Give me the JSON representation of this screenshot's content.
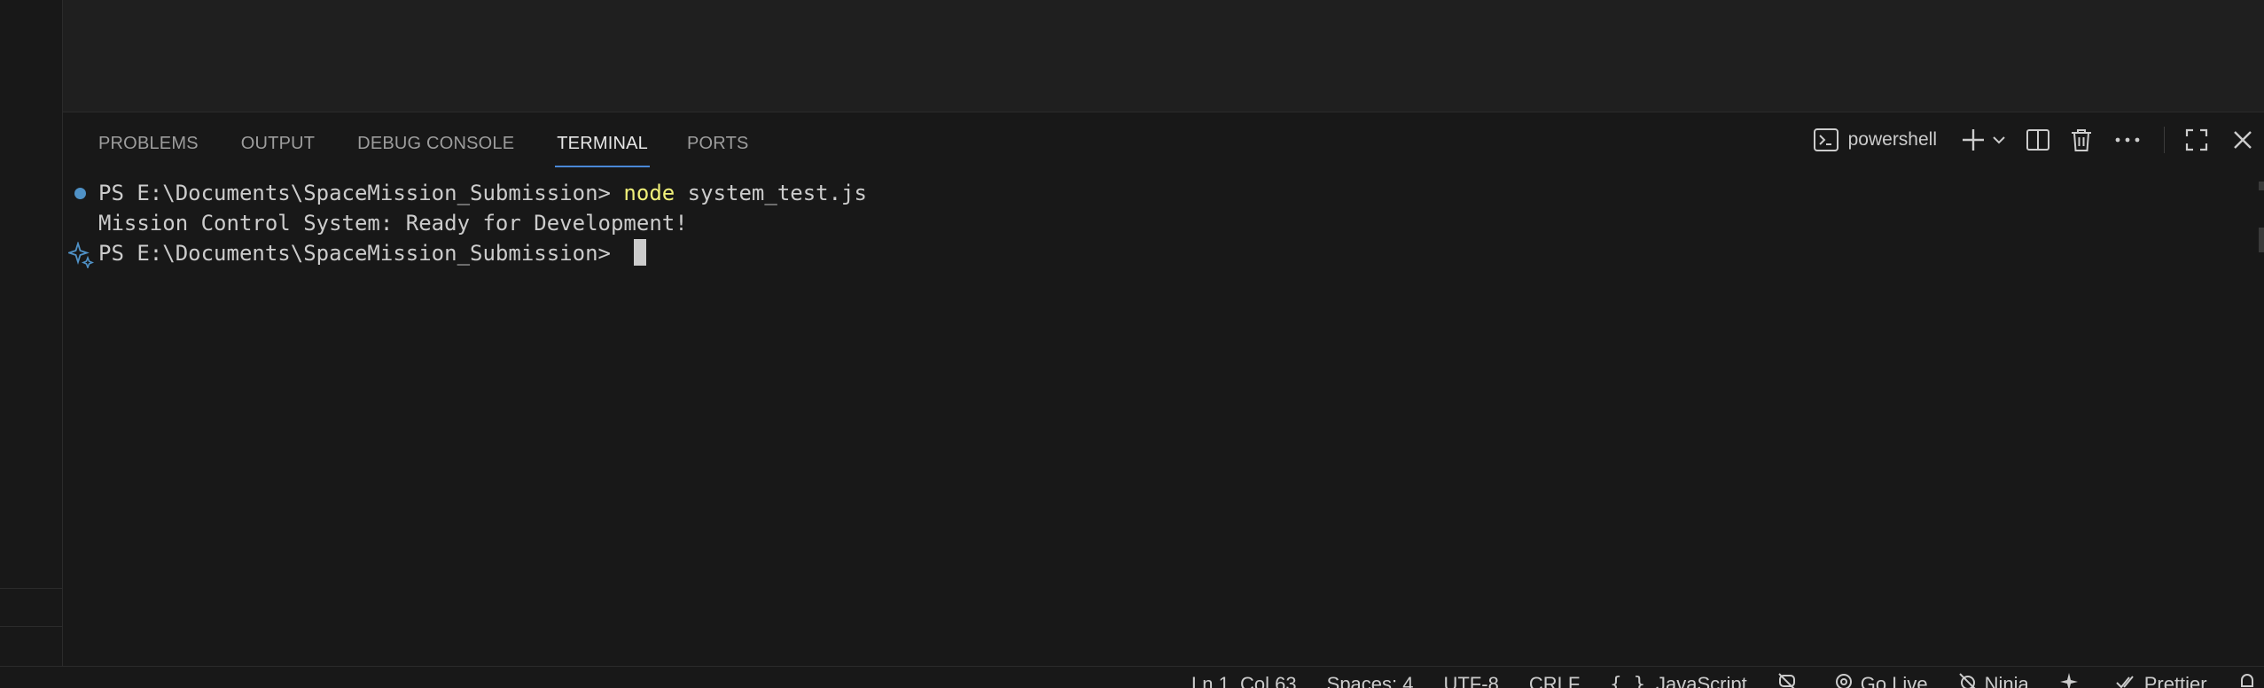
{
  "panel": {
    "tabs": [
      {
        "label": "PROBLEMS",
        "active": false
      },
      {
        "label": "OUTPUT",
        "active": false
      },
      {
        "label": "DEBUG CONSOLE",
        "active": false
      },
      {
        "label": "TERMINAL",
        "active": true
      },
      {
        "label": "PORTS",
        "active": false
      }
    ],
    "actions": {
      "shell_label": "powershell",
      "icons": [
        "terminal-icon",
        "plus-icon",
        "chevron-down-icon",
        "split-icon",
        "trash-icon",
        "more-icon",
        "maximize-icon",
        "close-icon"
      ]
    }
  },
  "terminal": {
    "line1": {
      "prompt": "PS E:\\Documents\\SpaceMission_Submission> ",
      "command": "node",
      "args": " system_test.js"
    },
    "line2": {
      "output": "Mission Control System: Ready for Development!"
    },
    "line3": {
      "prompt": "PS E:\\Documents\\SpaceMission_Submission> "
    }
  },
  "statusbar": {
    "position": "Ln 1, Col 63",
    "spaces": "Spaces: 4",
    "encoding": "UTF-8",
    "eol": "CRLF",
    "language": "JavaScript",
    "go_live": "Go Live",
    "ninja": "Ninja",
    "prettier": "Prettier"
  },
  "colors": {
    "background": "#1f1f1f",
    "panel": "#181818",
    "accent": "#4a88d6",
    "command": "#f0f07a",
    "status_dot": "#4f91c6"
  }
}
